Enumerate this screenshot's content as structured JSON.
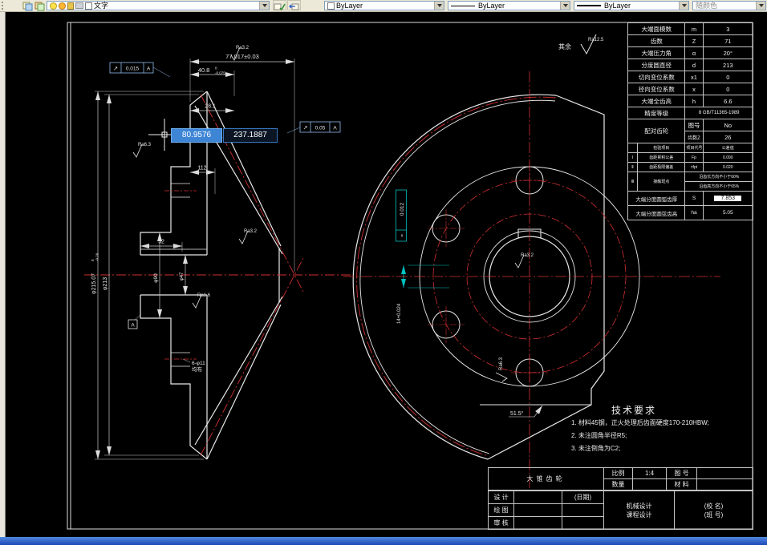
{
  "toolbar": {
    "layer_combo": {
      "value": "文字"
    },
    "color_combo": {
      "value": "ByLayer"
    },
    "linetype_combo": {
      "value": "ByLayer"
    },
    "lineweight_combo": {
      "value": "ByLayer"
    },
    "plotstyle_combo": {
      "value": "随颜色"
    }
  },
  "dynamic_input": {
    "x": "80.9576",
    "y": "237.1887"
  },
  "drawing": {
    "dims": {
      "total_width": "77.017±0.03",
      "rim_width": "40.8",
      "rim_width_tol_up": "0",
      "rim_width_tol_dn": "-0.075",
      "back_width": "28.1",
      "cone_dist": "112",
      "hub_len": "52",
      "hub_dia": "φ90",
      "bore_dia": "φ47",
      "tip_dia": "φ215.07",
      "tip_dia_tol_up": "0",
      "tip_dia_tol_dn": "-0.29",
      "pitch_dia": "φ213",
      "bolt_holes": "6-φ11",
      "bolt_holes_note": "均布",
      "keyway_width": "14+0.024",
      "corner_angle": "51.5°"
    },
    "fcf1": {
      "sym": "↗",
      "val": "0.015",
      "datum": "A"
    },
    "fcf2": {
      "sym": "↗",
      "val": "0.05",
      "datum": "A"
    },
    "fcf3": {
      "sym": "=",
      "val": "0.012"
    },
    "ra": {
      "top": "Ra3.2",
      "back": "Ra6.3",
      "flank": "Ra3.2",
      "bore": "Ra1.6",
      "keyway": "Ra3.2",
      "hub": "Ra6.3",
      "rest_label": "其余",
      "rest": "Ra12.5"
    },
    "datum_label": "A"
  },
  "gear_table": {
    "rows": [
      {
        "label": "大端面模数",
        "sym": "m",
        "val": "3"
      },
      {
        "label": "齿数",
        "sym": "Z",
        "val": "71"
      },
      {
        "label": "大端压力角",
        "sym": "α",
        "val": "20°"
      },
      {
        "label": "分度圆直径",
        "sym": "d",
        "val": "213"
      },
      {
        "label": "切向变位系数",
        "sym": "x1",
        "val": "0"
      },
      {
        "label": "径向变位系数",
        "sym": "x",
        "val": "0"
      },
      {
        "label": "大端全齿高",
        "sym": "h",
        "val": "6.6"
      }
    ],
    "accuracy_label": "精度等级",
    "accuracy_val": "8 GB/T11365-1989",
    "mate_label": "配对齿轮",
    "mate_fig_label": "图号",
    "mate_fig_val": "No",
    "mate_teeth_label": "齿数",
    "mate_teeth_sym": "Z",
    "mate_teeth_val": "26",
    "insp_header": {
      "item": "检验项目",
      "code": "项目代号",
      "tol": "公差值"
    },
    "insp_rows": [
      {
        "g": "Ⅰ",
        "item": "齿距累积公差",
        "code": "Fp",
        "val": "0.090"
      },
      {
        "g": "Ⅱ",
        "item": "齿距极限偏差",
        "code": "±fpt",
        "val": "0.020"
      }
    ],
    "contact": {
      "g": "Ⅲ",
      "item": "接触斑点",
      "line1": "沿齿长方向不小于60%",
      "line2": "沿齿高方向不小于65%"
    },
    "thickness_label": "大端分度圆弧齿厚",
    "thickness_sym": "S",
    "thickness_val": "7.853",
    "chordal_label": "大端分度圆弦齿高",
    "chordal_sym": "ha",
    "chordal_val": "5.05"
  },
  "tech": {
    "title": "技术要求",
    "items": [
      "1. 材料45钢，正火处理后齿面硬度170-210HBW;",
      "2. 未注圆角半径R5;",
      "3. 未注倒角为C2;"
    ]
  },
  "title_block": {
    "name": "大锥齿轮",
    "scale_label": "比例",
    "scale": "1:4",
    "qty_label": "数量",
    "qty": "",
    "fig_label": "图 号",
    "fig": "",
    "mat_label": "材 料",
    "mat": "",
    "design_label": "设 计",
    "date_label": "(日期)",
    "draw_label": "绘 图",
    "check_label": "审 核",
    "course_line1": "机械设计",
    "course_line2": "课程设计",
    "org_line1": "(校 名)",
    "org_line2": "(班 号)"
  }
}
